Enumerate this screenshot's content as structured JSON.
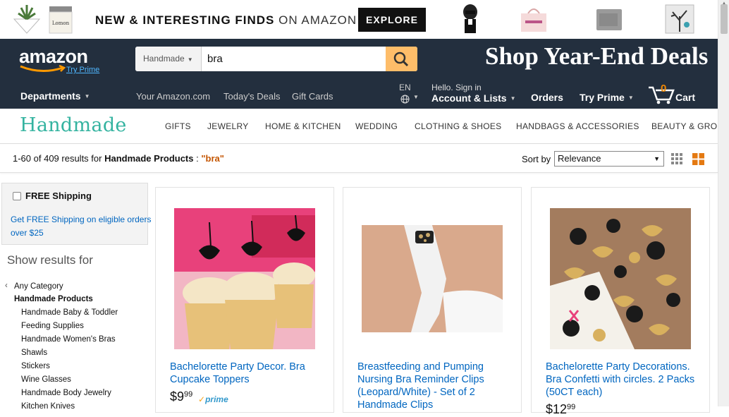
{
  "banner": {
    "text_bold": "NEW & INTERESTING FINDS",
    "text_light": "ON AMAZON",
    "explore_label": "EXPLORE"
  },
  "nav": {
    "logo_text": "amazon",
    "try_prime_link": "Try Prime",
    "search_dept": "Handmade",
    "search_value": "bra",
    "promo": "Shop Year-End Deals",
    "departments": "Departments",
    "links": [
      "Your Amazon.com",
      "Today's Deals",
      "Gift Cards"
    ],
    "language": "EN",
    "hello": "Hello. Sign in",
    "account": "Account & Lists",
    "orders": "Orders",
    "try_prime": "Try Prime",
    "cart_count": "0",
    "cart_label": "Cart"
  },
  "handmade": {
    "logo": "Handmade",
    "categories": [
      "GIFTS",
      "JEWELRY",
      "HOME & KITCHEN",
      "WEDDING",
      "CLOTHING & SHOES",
      "HANDBAGS & ACCESSORIES",
      "BEAUTY & GROC"
    ]
  },
  "results": {
    "count_text": "1-60 of 409 results for ",
    "store": "Handmade Products",
    "sep": " : ",
    "query": "\"bra\"",
    "sort_label": "Sort by",
    "sort_value": "Relevance"
  },
  "sidebar": {
    "free_shipping": "FREE Shipping",
    "free_shipping_desc": "Get FREE Shipping on eligible orders over $25",
    "show_results_for": "Show results for",
    "any_category": "Any Category",
    "current_category": "Handmade Products",
    "subcategories": [
      "Handmade Baby & Toddler",
      "Feeding Supplies",
      "Handmade Women's Bras",
      "Shawls",
      "Stickers",
      "Wine Glasses",
      "Handmade Body Jewelry",
      "Kitchen Knives"
    ]
  },
  "products": [
    {
      "title": "Bachelorette Party Decor. Bra Cupcake Toppers",
      "price_whole": "$9",
      "price_fraction": "99",
      "prime": "prime"
    },
    {
      "title": "Breastfeeding and Pumping Nursing Bra Reminder Clips (Leopard/White) - Set of 2 Handmade Clips",
      "price_whole": "",
      "price_fraction": "",
      "prime": ""
    },
    {
      "title": "Bachelorette Party Decorations. Bra Confetti with circles. 2 Packs (50CT each)",
      "price_whole": "$12",
      "price_fraction": "99",
      "prime": ""
    }
  ],
  "colors": {
    "nav_bg": "#232f3e",
    "search_button": "#febd69",
    "link_blue": "#0066c0",
    "handmade_teal": "#34b3a0",
    "query_orange": "#c45500"
  }
}
